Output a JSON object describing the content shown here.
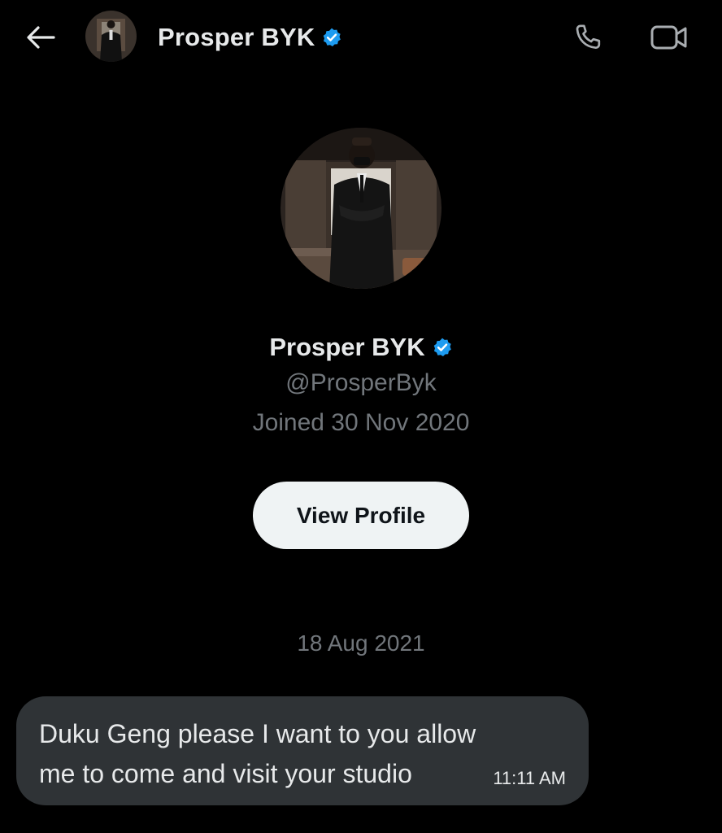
{
  "header": {
    "contact_name": "Prosper BYK",
    "back_icon": "arrow-left-icon",
    "call_icon": "phone-icon",
    "video_icon": "video-camera-icon",
    "verified_icon": "verified-badge-icon"
  },
  "profile": {
    "name": "Prosper BYK",
    "handle": "@ProsperByk",
    "joined": "Joined 30 Nov 2020",
    "view_profile_label": "View Profile"
  },
  "conversation": {
    "date_separator": "18 Aug 2021",
    "messages": [
      {
        "text": "Duku Geng please I want to you allow me to come and visit your studio",
        "time": "11:11 AM",
        "direction": "incoming"
      }
    ]
  },
  "colors": {
    "background": "#000000",
    "primary_text": "#e7e9ea",
    "secondary_text": "#71767b",
    "verified_blue": "#1d9bf0",
    "bubble_incoming": "#2f3336",
    "button_bg": "#eff3f4"
  }
}
